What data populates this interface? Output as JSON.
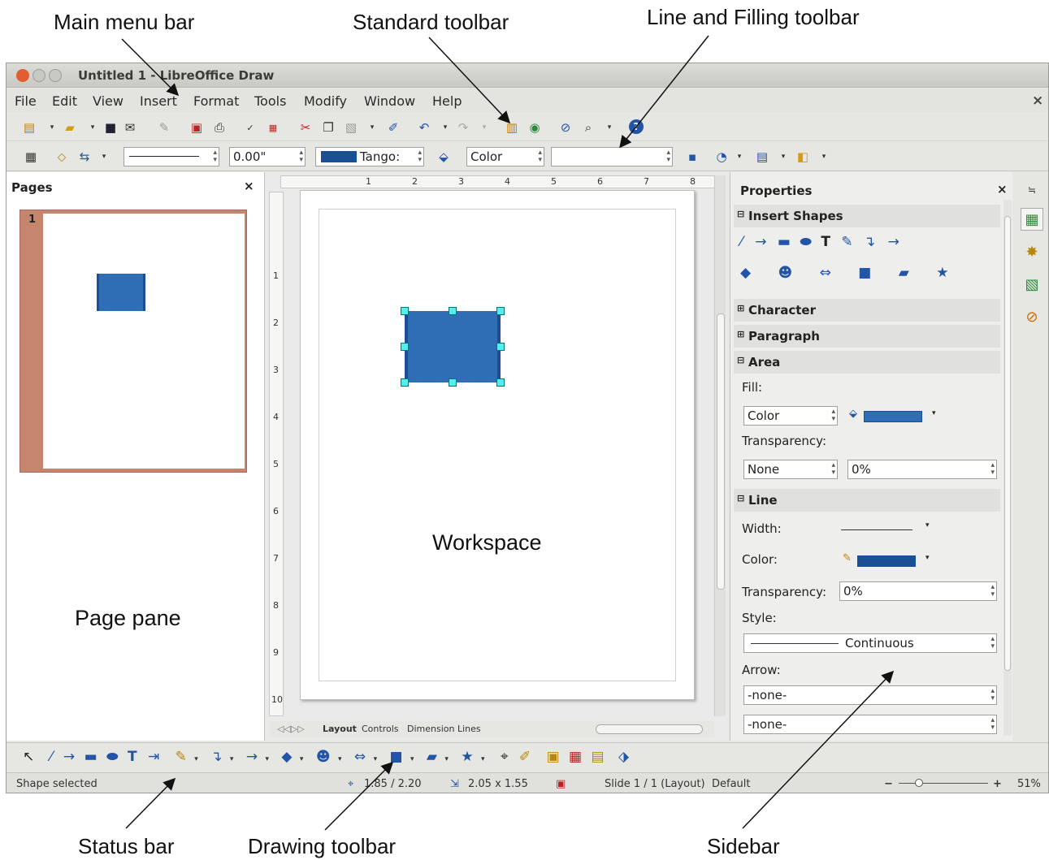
{
  "callouts": {
    "main_menu_bar": "Main menu bar",
    "standard_toolbar": "Standard toolbar",
    "line_filling_toolbar": "Line and Filling toolbar",
    "status_bar": "Status bar",
    "drawing_toolbar": "Drawing toolbar",
    "sidebar": "Sidebar",
    "page_pane": "Page pane",
    "workspace": "Workspace"
  },
  "window": {
    "title": "Untitled 1 - LibreOffice Draw",
    "close_glyph": "×"
  },
  "menubar": {
    "items": [
      "File",
      "Edit",
      "View",
      "Insert",
      "Format",
      "Tools",
      "Modify",
      "Window",
      "Help"
    ]
  },
  "line_fill_toolbar": {
    "line_width_value": "0.00\"",
    "color_palette": "Tango:",
    "area_style": "Color",
    "area_fill_value": ""
  },
  "pages_pane": {
    "title": "Pages",
    "close_glyph": "×",
    "page_number": "1"
  },
  "ruler": {
    "h_ticks": [
      "1",
      "2",
      "3",
      "4",
      "5",
      "6",
      "7",
      "8"
    ],
    "v_ticks": [
      "1",
      "2",
      "3",
      "4",
      "5",
      "6",
      "7",
      "8",
      "9",
      "10"
    ]
  },
  "workspace_tabs": [
    "Layout",
    "Controls",
    "Dimension Lines"
  ],
  "sidebar": {
    "title": "Properties",
    "close_glyph": "×",
    "sections": {
      "insert_shapes": "Insert Shapes",
      "character": "Character",
      "paragraph": "Paragraph",
      "area": "Area",
      "line": "Line"
    },
    "area": {
      "fill_label": "Fill:",
      "fill_value": "Color",
      "transparency_label": "Transparency:",
      "transparency_type": "None",
      "transparency_value": "0%"
    },
    "line": {
      "width_label": "Width:",
      "color_label": "Color:",
      "transparency_label": "Transparency:",
      "transparency_value": "0%",
      "style_label": "Style:",
      "style_value": "Continuous",
      "arrow_label": "Arrow:",
      "arrow_start": "-none-",
      "arrow_end": "-none-"
    }
  },
  "statusbar": {
    "selection": "Shape selected",
    "position": "1.85 / 2.20",
    "size": "2.05 x 1.55",
    "slide": "Slide 1 / 1 (Layout)",
    "master": "Default",
    "zoom": "51%"
  },
  "colors": {
    "shape_blue": "#2f6eb5",
    "line_blue": "#1b4f95",
    "page_border": "#c6866e",
    "handle": "#55e0e0"
  }
}
